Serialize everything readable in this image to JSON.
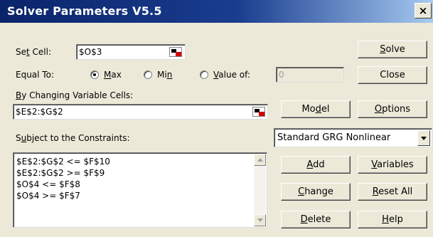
{
  "window": {
    "title": "Solver Parameters V5.5",
    "close_glyph": "×"
  },
  "set_cell": {
    "label_pre": "Se",
    "label_key": "t",
    "label_post": " Cell:",
    "value": "$O$3"
  },
  "equal_to": {
    "label": "Equal To:",
    "max_label_key": "M",
    "max_label_rest": "ax",
    "min_label_pre": "Mi",
    "min_label_key": "n",
    "value_label_pre": "",
    "value_label_key": "V",
    "value_label_rest": "alue of:",
    "selected": "max",
    "value_of": "0"
  },
  "changing_cells": {
    "label_key": "B",
    "label_rest": "y Changing Variable Cells:",
    "value": "$E$2:$G$2"
  },
  "constraints": {
    "label_pre": "S",
    "label_key": "u",
    "label_rest": "bject to the Constraints:",
    "items": [
      "$E$2:$G$2 <= $F$10",
      "$E$2:$G$2 >= $F$9",
      "$O$4 <= $F$8",
      "$O$4 >= $F$7"
    ]
  },
  "engine": {
    "selected": "Standard GRG Nonlinear"
  },
  "buttons": {
    "solve_key": "S",
    "solve_rest": "olve",
    "close": "Close",
    "model_pre": "Mo",
    "model_key": "d",
    "model_rest": "el",
    "options_key": "O",
    "options_rest": "ptions",
    "add_key": "A",
    "add_rest": "dd",
    "variables_key": "V",
    "variables_rest": "ariables",
    "change_key": "C",
    "change_rest": "hange",
    "reset_pre": "",
    "reset_key": "R",
    "reset_rest": "eset All",
    "delete_key": "D",
    "delete_rest": "elete",
    "help_key": "H",
    "help_rest": "elp"
  }
}
